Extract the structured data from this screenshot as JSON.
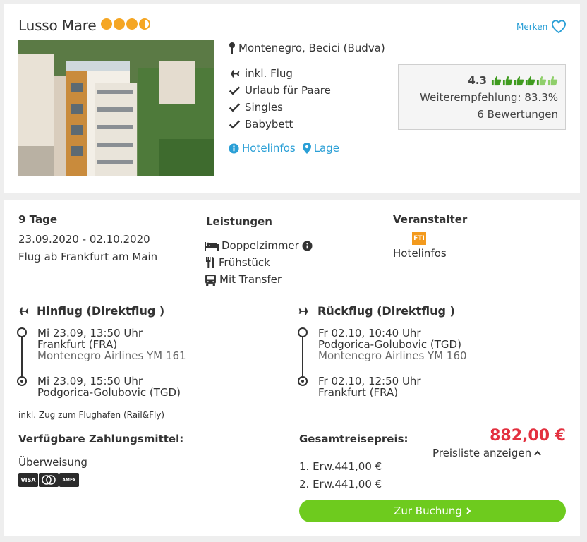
{
  "hotel": {
    "name": "Lusso Mare",
    "stars": 3.5,
    "merken_label": "Merken",
    "location": "Montenegro, Becici (Budva)",
    "features": [
      "inkl. Flug",
      "Urlaub für Paare",
      "Singles",
      "Babybett"
    ],
    "links": {
      "hotelinfos": "Hotelinfos",
      "lage": "Lage"
    }
  },
  "rating": {
    "score": "4.3",
    "recommendation": "Weiterempfehlung: 83.3%",
    "reviews": "6 Bewertungen"
  },
  "offer": {
    "duration": "9 Tage",
    "dates": "23.09.2020 - 02.10.2020",
    "departure": "Flug ab Frankfurt am Main",
    "services_title": "Leistungen",
    "services": [
      "Doppelzimmer",
      "Frühstück",
      "Mit Transfer"
    ],
    "operator_title": "Veranstalter",
    "operator_logo": "FTI",
    "operator_link": "Hotelinfos"
  },
  "outbound": {
    "title": "Hinflug (Direktflug )",
    "dep_time": "Mi 23.09, 13:50 Uhr",
    "dep_airport": "Frankfurt (FRA)",
    "airline": "Montenegro Airlines YM 161",
    "arr_time": "Mi 23.09, 15:50 Uhr",
    "arr_airport": "Podgorica-Golubovic (TGD)"
  },
  "return": {
    "title": "Rückflug (Direktflug )",
    "dep_time": "Fr 02.10, 10:40 Uhr",
    "dep_airport": "Podgorica-Golubovic (TGD)",
    "airline": "Montenegro Airlines YM 160",
    "arr_time": "Fr 02.10, 12:50 Uhr",
    "arr_airport": "Frankfurt (FRA)"
  },
  "rail_note": "inkl. Zug zum Flughafen (Rail&Fly)",
  "payment": {
    "title": "Verfügbare Zahlungsmittel:",
    "method": "Überweisung",
    "cards": [
      "VISA",
      "MC",
      "AMEX"
    ]
  },
  "pricing": {
    "title": "Gesamtreisepreis:",
    "total": "882,00 €",
    "toggle": "Preisliste anzeigen",
    "lines": [
      "1. Erw.441,00 €",
      "2. Erw.441,00 €"
    ],
    "book_label": "Zur Buchung"
  },
  "colors": {
    "accent": "#2a9fd6",
    "price": "#e3303f",
    "button": "#6ecb1e",
    "stars": "#f5a623",
    "thumbs": "#3f9b1f"
  }
}
